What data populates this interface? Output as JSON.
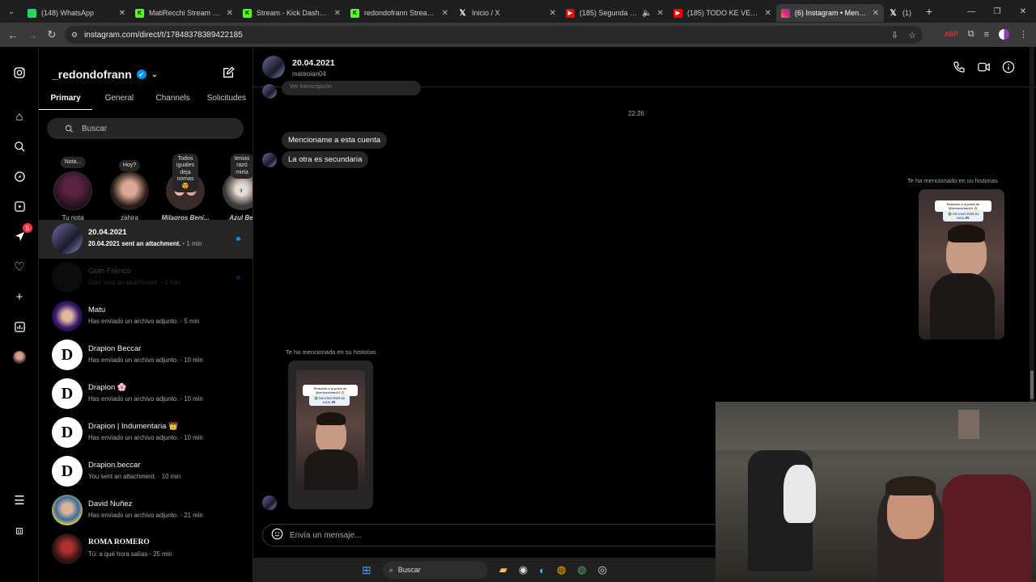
{
  "browser": {
    "tabs": [
      {
        "title": "(148) WhatsApp",
        "color": "#25d366"
      },
      {
        "title": "MatiRecchi Stream - Wa",
        "color": "#53fc18"
      },
      {
        "title": "Stream - Kick Dashboard",
        "color": "#53fc18"
      },
      {
        "title": "redondofrann Stream -",
        "color": "#53fc18"
      },
      {
        "title": "Inicio / X",
        "color": "#ffffff"
      },
      {
        "title": "(185) Segunda vela",
        "color": "#ff0000"
      },
      {
        "title": "(185) TODO KE VER (Tu",
        "color": "#ff0000"
      },
      {
        "title": "(6) Instagram • Mensajes",
        "color": "#e1306c"
      },
      {
        "title": "(1)",
        "color": "#ffffff"
      }
    ],
    "url": "instagram.com/direct/t/17848378389422185"
  },
  "rail": {
    "icons": [
      "instagram-icon",
      "home-icon",
      "search-icon",
      "explore-icon",
      "reels-icon",
      "messages-icon",
      "heart-icon",
      "create-icon",
      "dashboard-icon",
      "profile-icon",
      "menu-icon",
      "threads-icon"
    ],
    "messages_badge": "5"
  },
  "sidebar": {
    "account": "_redondofrann",
    "tabs": [
      "Primary",
      "General",
      "Channels",
      "Solicitudes"
    ],
    "search_placeholder": "Buscar",
    "notes": [
      {
        "bubble": "Nota...",
        "name": "Tu nota"
      },
      {
        "bubble": "Hoy?",
        "name": "zahira"
      },
      {
        "bubble": "Todos iguales\ndeja nomas😍",
        "name": "Milagros Beni..."
      },
      {
        "bubble": "tenias razó\nmirta",
        "name": "Azul Bel"
      }
    ],
    "conversations": [
      {
        "name": "20.04.2021",
        "sub": "20.04.2021 sent an attachment.",
        "time": "1 min"
      },
      {
        "name": "Gian Franco",
        "sub": "Gian sent an attachment.",
        "time": "1 min"
      },
      {
        "name": "Matu",
        "sub": "Has enviado un archivo adjunto.",
        "time": "5 min"
      },
      {
        "name": "Drapion Beccar",
        "sub": "Has enviado un archivo adjunto.",
        "time": "10 min"
      },
      {
        "name": "Drapion 🌸",
        "sub": "Has enviado un archivo adjunto.",
        "time": "10 min"
      },
      {
        "name": "Drapion | Indumentaria 👑",
        "sub": "Has enviado un archivo adjunto.",
        "time": "10 min"
      },
      {
        "name": "Drapion.beccar",
        "sub": "You sent an attachment.",
        "time": "10 min"
      },
      {
        "name": "David Nuñez",
        "sub": "Has enviado un archivo adjunto.",
        "time": "21 min"
      },
      {
        "name": "ROMA ROMERO",
        "sub": "Tú: a qué hora salías",
        "time": "25 min"
      }
    ]
  },
  "chat": {
    "title": "20.04.2021",
    "username": "mateoian04",
    "partial_top": "Ver transcripción",
    "timestamp": "22:26",
    "messages": [
      "Mencioname a esta cuenta",
      "La otra es secundaria"
    ],
    "mention_right": "Te ha mencionado en su historias",
    "mention_left": "Te ha mencionado en su historias",
    "story_caption": "Reacción a la polea de @redondofran04 🔥",
    "story_live": "🟢 EN VIVO POR MI KICK 🎮",
    "input_placeholder": "Envía un mensaje..."
  },
  "taskbar": {
    "search": "Buscar"
  }
}
